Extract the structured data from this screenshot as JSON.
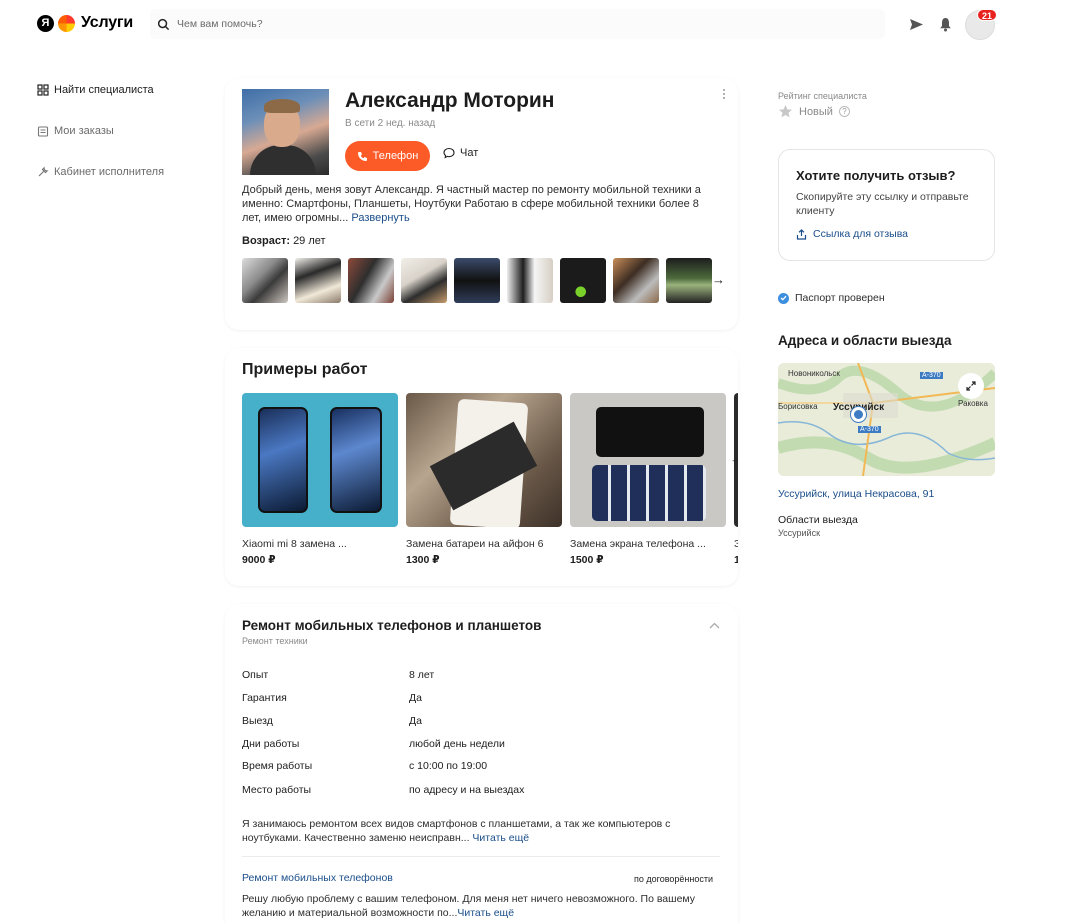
{
  "header": {
    "logo_letter": "Я",
    "logo_text": "Услуги",
    "search_placeholder": "Чем вам помочь?",
    "notifications_count": "21"
  },
  "nav": {
    "items": [
      {
        "label": "Найти специалиста",
        "icon": "grid-icon"
      },
      {
        "label": "Мои заказы",
        "icon": "orders-icon"
      },
      {
        "label": "Кабинет исполнителя",
        "icon": "wrench-icon"
      }
    ]
  },
  "profile": {
    "name": "Александр Моторин",
    "online": "В сети 2 нед. назад",
    "phone_label": "Телефон",
    "chat_label": "Чат",
    "about": "Добрый день, меня зовут Александр. Я частный мастер по ремонту мобильной техники а именно: Смартфоны, Планшеты, Ноутбуки Работаю в сфере мобильной техники более 8 лет, имею огромны...",
    "expand_label": "Развернуть",
    "age_label": "Возраст:",
    "age_value": "29 лет"
  },
  "works": {
    "title": "Примеры работ",
    "items": [
      {
        "title": "Xiaomi mi 8 замена ...",
        "price": "9000 ₽"
      },
      {
        "title": "Замена батареи на айфон 6",
        "price": "1300 ₽"
      },
      {
        "title": "Замена экрана телефона ...",
        "price": "1500 ₽"
      },
      {
        "title": "З",
        "price": "1"
      }
    ]
  },
  "service": {
    "title": "Ремонт мобильных телефонов и планшетов",
    "subtitle": "Ремонт техники",
    "rows": [
      {
        "key": "Опыт",
        "value": "8 лет"
      },
      {
        "key": "Гарантия",
        "value": "Да"
      },
      {
        "key": "Выезд",
        "value": "Да"
      },
      {
        "key": "Дни работы",
        "value": "любой день недели"
      },
      {
        "key": "Время работы",
        "value": "с 10:00 по 19:00"
      },
      {
        "key": "Место работы",
        "value": "по адресу и на выездах"
      }
    ],
    "description": "Я занимаюсь ремонтом всех видов смартфонов с планшетами, а так же компьютеров с ноутбуками. Качественно заменю неисправн...",
    "read_more": "Читать ещё",
    "sub_service": {
      "title": "Ремонт мобильных телефонов",
      "price": "по договорённости",
      "description": "Решу любую проблему с вашим телефоном. Для меня нет ничего невозможного. По вашему желанию и материальной возможности по...",
      "read_more": "Читать ещё"
    }
  },
  "sidebar": {
    "rating_label": "Рейтинг специалиста",
    "rating_value": "Новый",
    "review_title": "Хотите получить отзыв?",
    "review_desc": "Скопируйте эту ссылку и отправьте клиенту",
    "review_link": "Ссылка для отзыва",
    "passport": "Паспорт проверен",
    "address_title": "Адреса и области выезда",
    "map_labels": {
      "city": "Уссурийск",
      "north": "Новоникольск",
      "west": "Борисовка",
      "east": "Раковка",
      "road1": "А-370",
      "road2": "А-370"
    },
    "address": "Уссурийск, улица Некрасова, 91",
    "areas_title": "Области выезда",
    "areas_value": "Уссурийск"
  },
  "colors": {
    "accent": "#fc5a26",
    "link": "#1a4e8a",
    "badge": "#e8231f",
    "verified": "#3c8ede"
  }
}
